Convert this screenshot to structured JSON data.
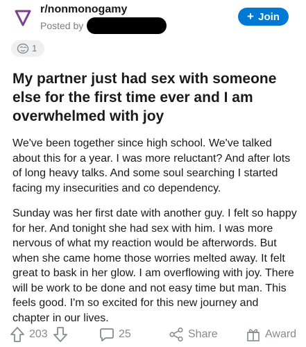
{
  "header": {
    "subreddit": "r/nonmonogamy",
    "posted_by_prefix": "Posted by",
    "join_plus": "+",
    "join_label": "Join"
  },
  "awards": {
    "count": "1"
  },
  "post": {
    "title": "My partner just had sex with someone else for the first time ever and I am overwhelmed with joy",
    "paragraphs": [
      "We've been together since high school. We've talked about this for a year. I was more reluctant? And after lots of long heavy talks. And some soul searching I started facing my insecurities and co dependency.",
      "Sunday was her first date with another guy. I felt so happy for her. And tonight she had sex with him. I was more nervous of what my reaction would be afterwords. But when she came home those worries melted away. It felt great to bask in her glow. I am overflowing with joy. There will be work to be done and not easy time but man. This feels good. I'm so excited for this new journey and chapter in our lives."
    ]
  },
  "actions": {
    "upvotes": "203",
    "comments": "25",
    "share_label": "Share",
    "award_label": "Award"
  },
  "colors": {
    "brand_blue": "#0079d3",
    "subreddit_icon": "#7e3f8f",
    "muted_text": "#878a8c"
  },
  "icons": [
    "subreddit-triangle-icon",
    "award-face-icon",
    "upvote-icon",
    "downvote-icon",
    "comment-icon",
    "share-icon",
    "gift-icon"
  ]
}
